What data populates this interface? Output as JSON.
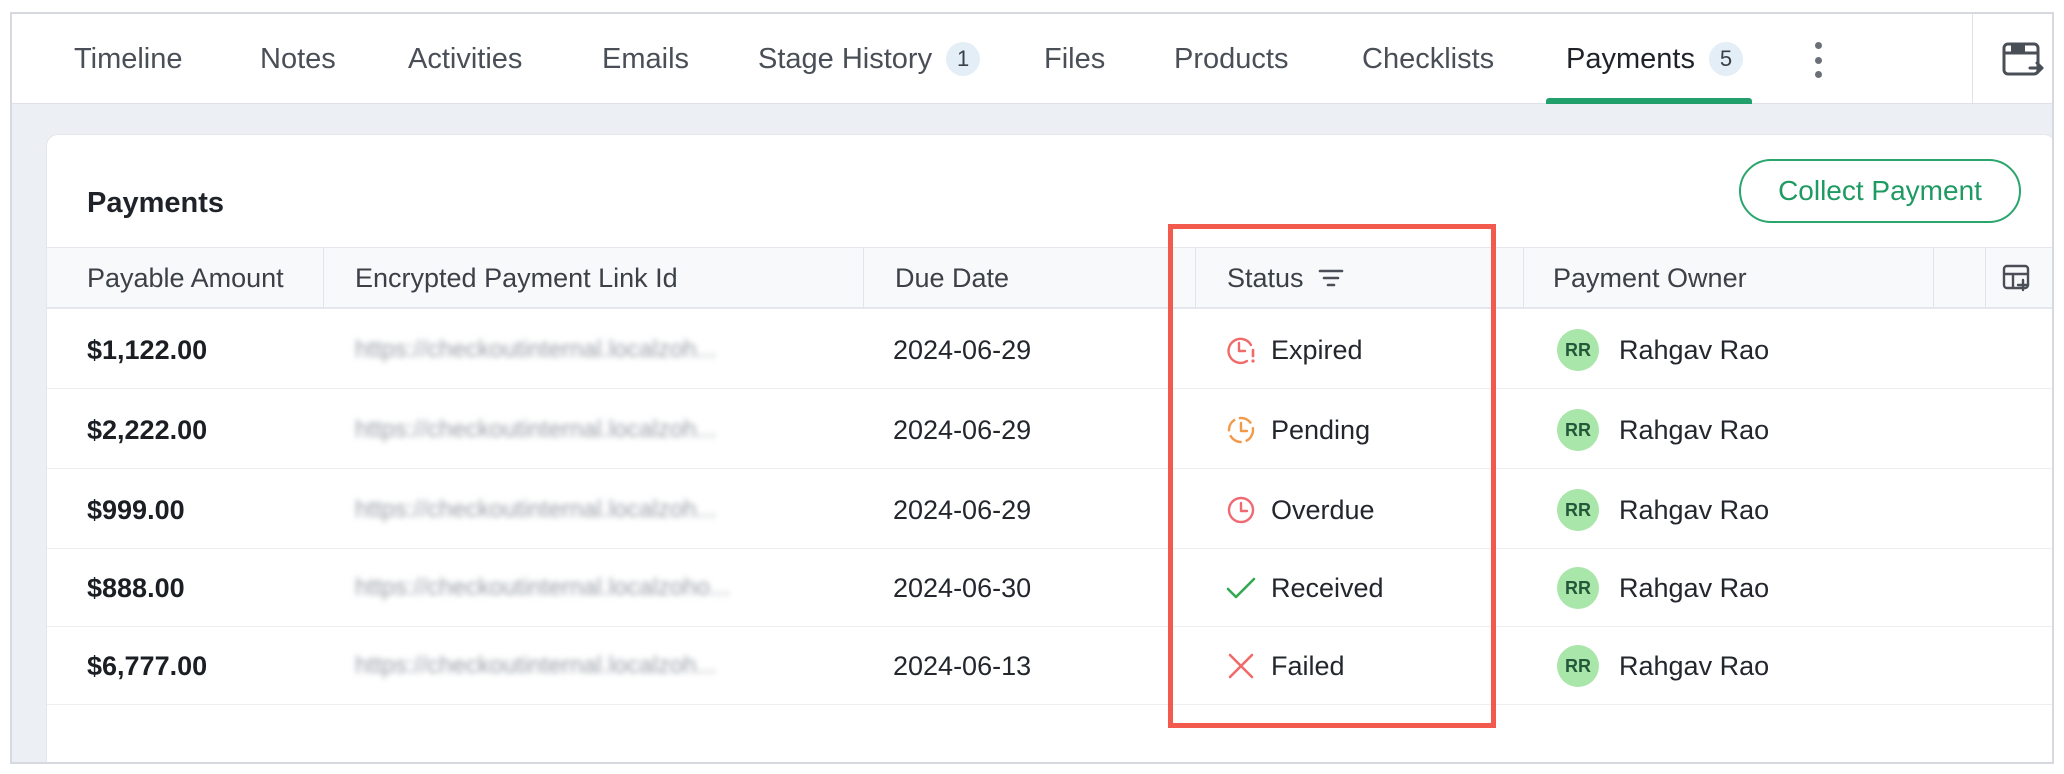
{
  "tabs": [
    {
      "label": "Timeline"
    },
    {
      "label": "Notes"
    },
    {
      "label": "Activities"
    },
    {
      "label": "Emails"
    },
    {
      "label": "Stage History",
      "count": "1"
    },
    {
      "label": "Files"
    },
    {
      "label": "Products"
    },
    {
      "label": "Checklists"
    },
    {
      "label": "Payments",
      "count": "5",
      "active": true
    }
  ],
  "card": {
    "title": "Payments",
    "collect_button": "Collect Payment"
  },
  "table": {
    "columns": [
      "Payable Amount",
      "Encrypted Payment Link Id",
      "Due Date",
      "Status",
      "Payment Owner"
    ],
    "rows": [
      {
        "amount": "$1,122.00",
        "link": "https://checkoutinternal.localzoh...",
        "due": "2024-06-29",
        "status": "Expired",
        "status_icon": "clock-alert-icon",
        "owner_initials": "RR",
        "owner": "Rahgav Rao"
      },
      {
        "amount": "$2,222.00",
        "link": "https://checkoutinternal.localzoh...",
        "due": "2024-06-29",
        "status": "Pending",
        "status_icon": "clock-dashed-icon",
        "owner_initials": "RR",
        "owner": "Rahgav Rao"
      },
      {
        "amount": "$999.00",
        "link": "https://checkoutinternal.localzoh...",
        "due": "2024-06-29",
        "status": "Overdue",
        "status_icon": "clock-icon",
        "owner_initials": "RR",
        "owner": "Rahgav Rao"
      },
      {
        "amount": "$888.00",
        "link": "https://checkoutinternal.localzoho...",
        "due": "2024-06-30",
        "status": "Received",
        "status_icon": "check-icon",
        "owner_initials": "RR",
        "owner": "Rahgav Rao"
      },
      {
        "amount": "$6,777.00",
        "link": "https://checkoutinternal.localzoh...",
        "due": "2024-06-13",
        "status": "Failed",
        "status_icon": "x-icon",
        "owner_initials": "RR",
        "owner": "Rahgav Rao"
      }
    ]
  },
  "colors": {
    "accent_green": "#22a06b",
    "highlight_red": "#f25a4e",
    "expired": "#f06a6a",
    "pending": "#f39a4a",
    "overdue": "#ef6b73",
    "received": "#34a853",
    "failed": "#f06a6a"
  }
}
